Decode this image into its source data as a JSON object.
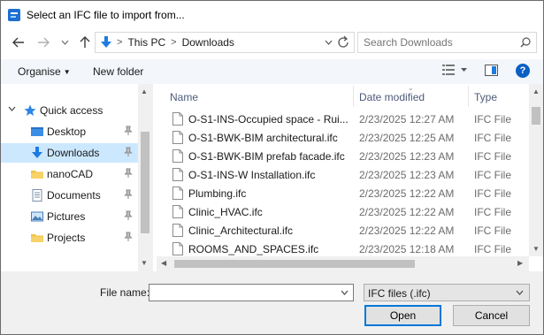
{
  "window": {
    "title": "Select an IFC file to import from...",
    "app_icon": "app-icon"
  },
  "navigation": {
    "back": "←",
    "forward": "→",
    "recent": "⌄",
    "up": "↑"
  },
  "address": {
    "crumbs": [
      "This PC",
      "Downloads"
    ],
    "separator": ">",
    "location_icon": "downloads-arrow-icon"
  },
  "search": {
    "placeholder": "Search Downloads"
  },
  "toolbar": {
    "organise_label": "Organise",
    "new_folder_label": "New folder",
    "help_label": "?"
  },
  "sidebar": {
    "items": [
      {
        "label": "Quick access",
        "icon": "star-icon",
        "expanded": true
      },
      {
        "label": "Desktop",
        "icon": "desktop-folder-icon",
        "pinned": true
      },
      {
        "label": "Downloads",
        "icon": "downloads-arrow-icon",
        "pinned": true,
        "selected": true
      },
      {
        "label": "nanoCAD",
        "icon": "folder-icon",
        "pinned": true
      },
      {
        "label": "Documents",
        "icon": "documents-icon",
        "pinned": true
      },
      {
        "label": "Pictures",
        "icon": "pictures-icon",
        "pinned": true
      },
      {
        "label": "Projects",
        "icon": "folder-icon",
        "pinned": true
      }
    ]
  },
  "file_list": {
    "columns": {
      "name": "Name",
      "date": "Date modified",
      "type": "Type"
    },
    "rows": [
      {
        "name": "O-S1-INS-Occupied space - Rui...",
        "date": "2/23/2025 12:27 AM",
        "type": "IFC File"
      },
      {
        "name": "O-S1-BWK-BIM architectural.ifc",
        "date": "2/23/2025 12:25 AM",
        "type": "IFC File"
      },
      {
        "name": "O-S1-BWK-BIM prefab facade.ifc",
        "date": "2/23/2025 12:23 AM",
        "type": "IFC File"
      },
      {
        "name": "O-S1-INS-W Installation.ifc",
        "date": "2/23/2025 12:23 AM",
        "type": "IFC File"
      },
      {
        "name": "Plumbing.ifc",
        "date": "2/23/2025 12:22 AM",
        "type": "IFC File"
      },
      {
        "name": "Clinic_HVAC.ifc",
        "date": "2/23/2025 12:22 AM",
        "type": "IFC File"
      },
      {
        "name": "Clinic_Architectural.ifc",
        "date": "2/23/2025 12:22 AM",
        "type": "IFC File"
      },
      {
        "name": "ROOMS_AND_SPACES.ifc",
        "date": "2/23/2025 12:18 AM",
        "type": "IFC File"
      }
    ]
  },
  "footer": {
    "file_name_label": "File name:",
    "file_name_value": "",
    "file_type_selected": "IFC files (.ifc)",
    "open_label": "Open",
    "cancel_label": "Cancel"
  },
  "colors": {
    "accent": "#0078d7",
    "selection": "#cce8ff",
    "command_bar": "#f3f6fb",
    "footer": "#f0f0f0"
  }
}
